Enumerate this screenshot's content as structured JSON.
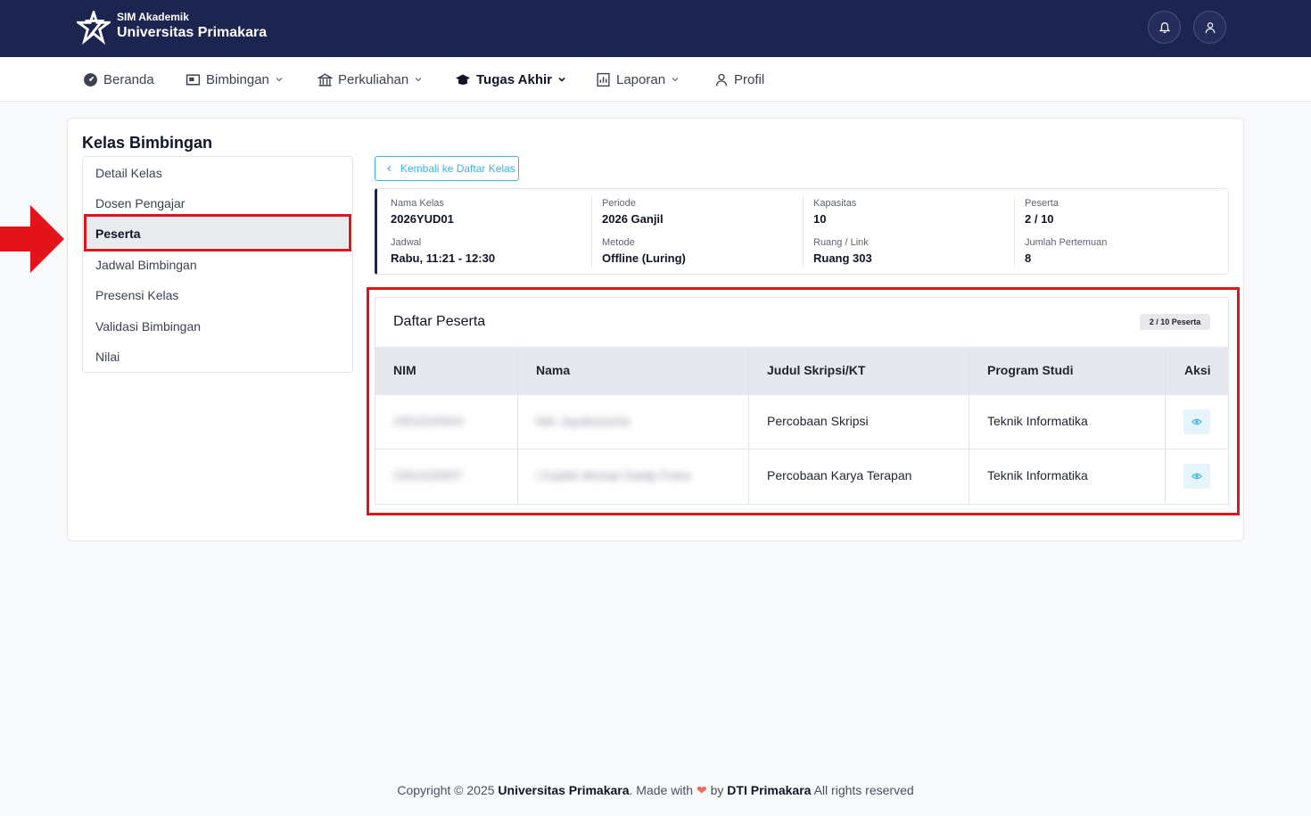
{
  "header": {
    "brand_sub": "SIM Akademik",
    "brand_main": "Universitas Primakara",
    "icons": [
      "bell-icon",
      "user-icon"
    ]
  },
  "nav": {
    "items": [
      {
        "label": "Beranda",
        "icon": "dashboard-icon"
      },
      {
        "label": "Bimbingan",
        "icon": "board-icon"
      },
      {
        "label": "Perkuliahan",
        "icon": "building-icon"
      },
      {
        "label": "Tugas Akhir",
        "icon": "graduation-cap-icon"
      },
      {
        "label": "Laporan",
        "icon": "report-icon"
      },
      {
        "label": "Profil",
        "icon": "user-icon"
      }
    ],
    "active": "Tugas Akhir"
  },
  "page": {
    "title": "Kelas Bimbingan",
    "back_label": "Kembali ke Daftar Kelas"
  },
  "sidebar": {
    "items": [
      {
        "label": "Detail Kelas"
      },
      {
        "label": "Dosen Pengajar"
      },
      {
        "label": "Peserta"
      },
      {
        "label": "Jadwal Bimbingan"
      },
      {
        "label": "Presensi Kelas"
      },
      {
        "label": "Validasi Bimbingan"
      },
      {
        "label": "Nilai"
      }
    ],
    "active": "Peserta"
  },
  "info": {
    "nama_kelas": {
      "label": "Nama Kelas",
      "value": "2026YUD01"
    },
    "periode": {
      "label": "Periode",
      "value": "2026 Ganjil"
    },
    "kapasitas": {
      "label": "Kapasitas",
      "value": "10"
    },
    "peserta": {
      "label": "Peserta",
      "value": "2 / 10"
    },
    "jadwal": {
      "label": "Jadwal",
      "value": "Rabu, 11:21 - 12:30"
    },
    "metode": {
      "label": "Metode",
      "value": "Offline (Luring)"
    },
    "ruang": {
      "label": "Ruang / Link",
      "value": "Ruang 303"
    },
    "pertemuan": {
      "label": "Jumlah Pertemuan",
      "value": "8"
    }
  },
  "peserta": {
    "title": "Daftar Peserta",
    "badge": "2 / 10 Peserta",
    "columns": [
      "NIM",
      "Nama",
      "Judul Skripsi/KT",
      "Program Studi",
      "Aksi"
    ],
    "rows": [
      {
        "nim": "2301020004",
        "nama": "Ilah Jayakusuma",
        "judul": "Percobaan Skripsi",
        "prodi": "Teknik Informatika",
        "action_icon": "eye-icon"
      },
      {
        "nim": "2301020007",
        "nama": "I Kadek Mumat Gadip Putra",
        "judul": "Percobaan Karya Terapan",
        "prodi": "Teknik Informatika",
        "action_icon": "eye-icon"
      }
    ]
  },
  "footer": {
    "prefix": "Copyright © 2025",
    "org": "Universitas Primakara",
    "made_with": ". Made with",
    "by": "by",
    "dev": "DTI Primakara",
    "suffix": "All rights reserved"
  },
  "colors": {
    "header_bg": "#1c2450",
    "accent": "#36b4e6",
    "highlight": "#e3131b",
    "heart": "#ee6b56"
  }
}
